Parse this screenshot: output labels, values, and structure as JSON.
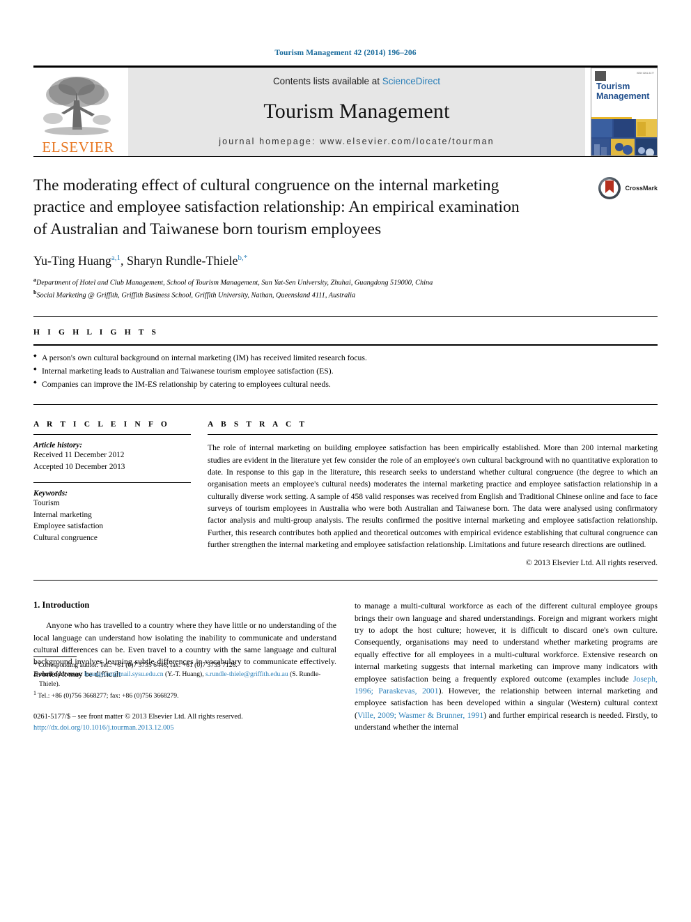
{
  "running_head": "Tourism Management 42 (2014) 196–206",
  "masthead": {
    "contents_prefix": "Contents lists available at ",
    "sciencedirect": "ScienceDirect",
    "journal_title": "Tourism Management",
    "homepage": "journal homepage: www.elsevier.com/locate/tourman",
    "elsevier_wordmark": "ELSEVIER",
    "cover_title_line1": "Tourism",
    "cover_title_line2": "Management"
  },
  "article": {
    "title": "The moderating effect of cultural congruence on the internal marketing practice and employee satisfaction relationship: An empirical examination of Australian and Taiwanese born tourism employees",
    "authors_plain": "Yu-Ting Huang a,1, Sharyn Rundle-Thiele b,*",
    "author_1_name": "Yu-Ting Huang",
    "author_1_sup": "a,1",
    "author_2_name": "Sharyn Rundle-Thiele",
    "author_2_sup": "b,*",
    "affiliation_a": "Department of Hotel and Club Management, School of Tourism Management, Sun Yat-Sen University, Zhuhai, Guangdong 519000, China",
    "affiliation_b": "Social Marketing @ Griffith, Griffith Business School, Griffith University, Nathan, Queensland 4111, Australia",
    "affil_a_marker": "a",
    "affil_b_marker": "b",
    "crossmark_label": "CrossMark"
  },
  "highlights": {
    "label": "H I G H L I G H T S",
    "items": [
      "A person's own cultural background on internal marketing (IM) has received limited research focus.",
      "Internal marketing leads to Australian and Taiwanese tourism employee satisfaction (ES).",
      "Companies can improve the IM-ES relationship by catering to employees cultural needs."
    ]
  },
  "article_info": {
    "label": "A R T I C L E   I N F O",
    "history_heading": "Article history:",
    "received": "Received 11 December 2012",
    "accepted": "Accepted 10 December 2013",
    "keywords_heading": "Keywords:",
    "keywords": [
      "Tourism",
      "Internal marketing",
      "Employee satisfaction",
      "Cultural congruence"
    ]
  },
  "abstract": {
    "label": "A B S T R A C T",
    "text": "The role of internal marketing on building employee satisfaction has been empirically established. More than 200 internal marketing studies are evident in the literature yet few consider the role of an employee's own cultural background with no quantitative exploration to date. In response to this gap in the literature, this research seeks to understand whether cultural congruence (the degree to which an organisation meets an employee's cultural needs) moderates the internal marketing practice and employee satisfaction relationship in a culturally diverse work setting. A sample of 458 valid responses was received from English and Traditional Chinese online and face to face surveys of tourism employees in Australia who were both Australian and Taiwanese born. The data were analysed using confirmatory factor analysis and multi-group analysis. The results confirmed the positive internal marketing and employee satisfaction relationship. Further, this research contributes both applied and theoretical outcomes with empirical evidence establishing that cultural congruence can further strengthen the internal marketing and employee satisfaction relationship. Limitations and future research directions are outlined.",
    "copyright": "© 2013 Elsevier Ltd. All rights reserved."
  },
  "body": {
    "section_number_title": "1. Introduction",
    "left_paragraph": "Anyone who has travelled to a country where they have little or no understanding of the local language can understand how isolating the inability to communicate and understand cultural differences can be. Even travel to a country with the same language and cultural background involves learning subtle differences in vocabulary to communicate effectively. In brief, it may be difficult",
    "right_paragraph_part1": "to manage a multi-cultural workforce as each of the different cultural employee groups brings their own language and shared understandings. Foreign and migrant workers might try to adopt the host culture; however, it is difficult to discard one's own culture. Consequently, organisations may need to understand whether marketing programs are equally effective for all employees in a multi-cultural workforce. Extensive research on internal marketing suggests that internal marketing can improve many indicators with employee satisfaction being a frequently explored outcome (examples include ",
    "citation_1": "Joseph, 1996; Paraskevas, 2001",
    "right_paragraph_part2": "). However, the relationship between internal marketing and employee satisfaction has been developed within a singular (Western) cultural context (",
    "citation_2": "Ville, 2009; Wasmer & Brunner, 1991",
    "right_paragraph_part3": ") and further empirical research is needed. Firstly, to understand whether the internal"
  },
  "footnotes": {
    "corresponding_marker": "*",
    "corresponding": "Corresponding author. Tel.: +61 (0)7 3735 6446; fax: +61 (0)7 3735 7126.",
    "email_heading": "E-mail addresses:",
    "email_1": "huangyout@mail.sysu.edu.cn",
    "email_1_owner": "(Y.-T. Huang),",
    "email_2": "s.rundle-thiele@griffith.edu.au",
    "email_2_owner": "(S. Rundle-Thiele).",
    "footnote_1_marker": "1",
    "footnote_1": "Tel.: +86 (0)756 3668277; fax: +86 (0)756 3668279.",
    "issn_line": "0261-5177/$ – see front matter © 2013 Elsevier Ltd. All rights reserved.",
    "doi": "http://dx.doi.org/10.1016/j.tourman.2013.12.005"
  },
  "colors": {
    "link": "#2a7fb8",
    "elsevier_orange": "#E87722",
    "cover_blue": "#1f4e8c"
  }
}
